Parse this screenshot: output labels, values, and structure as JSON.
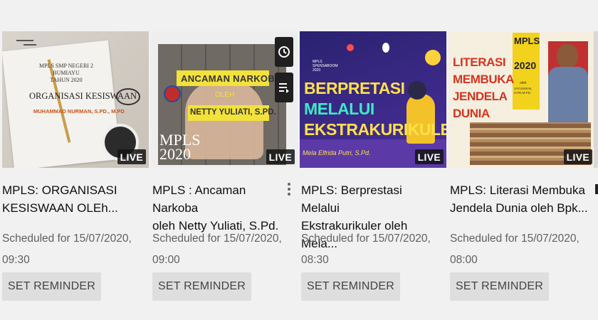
{
  "videos": [
    {
      "thumb": {
        "line1": "MPLS SMP NEGERI 2",
        "line2": "BUMIAYU",
        "line3": "TAHUN 2020",
        "heading": "ORGANISASI KESISWAAN",
        "byline": "MUHAMMAD NURMAN, S.PD., M.PD"
      },
      "badge": "LIVE",
      "title_line1": "MPLS: ORGANISASI",
      "title_line2": "KESISWAAN OLEh...",
      "meta_line1": "Scheduled for 15/07/2020,",
      "meta_line2": "09:30",
      "button": "SET REMINDER"
    },
    {
      "thumb": {
        "heading": "ANCAMAN NARKOBA",
        "oleh": "OLEH",
        "name": "NETTY YULIATI, S.PD.",
        "mpls": "MPLS",
        "year": "2020"
      },
      "badge": "LIVE",
      "title_line1": "MPLS : Ancaman Narkoba",
      "title_line2": "oleh Netty Yuliati, S.Pd.",
      "meta_line1": "Scheduled for 15/07/2020,",
      "meta_line2": "09:00",
      "button": "SET REMINDER"
    },
    {
      "thumb": {
        "small": "MPLS SPENSABOOM 2020",
        "line1": "BERPRETASI",
        "line2": "MELALUI",
        "line3": "EKSTRAKURIKULER",
        "byline": "Mela Elfrida Putri, S.Pd."
      },
      "badge": "LIVE",
      "title_line1": "MPLS: Berprestasi Melalui",
      "title_line2": "Ekstrakurikuler oleh Mela...",
      "meta_line1": "Scheduled for 15/07/2020,",
      "meta_line2": "08:30",
      "button": "SET REMINDER"
    },
    {
      "thumb": {
        "mpls": "MPLS",
        "year": "2020",
        "oleh": "oleh",
        "name": "JAYUSMAN, S.PD.M.PD.",
        "line1": "LITERASI",
        "line2": "MEMBUKA",
        "line3": "JENDELA",
        "line4": "DUNIA"
      },
      "badge": "LIVE",
      "title_line1": "MPLS: Literasi Membuka",
      "title_line2": "Jendela Dunia oleh Bpk...",
      "meta_line1": "Scheduled for 15/07/2020,",
      "meta_line2": "08:00",
      "button": "SET REMINDER"
    }
  ],
  "colors": {
    "background": "#f1f1f1",
    "title": "#0f0f0f",
    "meta": "#606060",
    "button_bg": "#dedede",
    "live_bg": "#1a1a1a"
  },
  "icons": [
    "watch-later-icon",
    "add-to-queue-icon",
    "more-options-icon"
  ]
}
